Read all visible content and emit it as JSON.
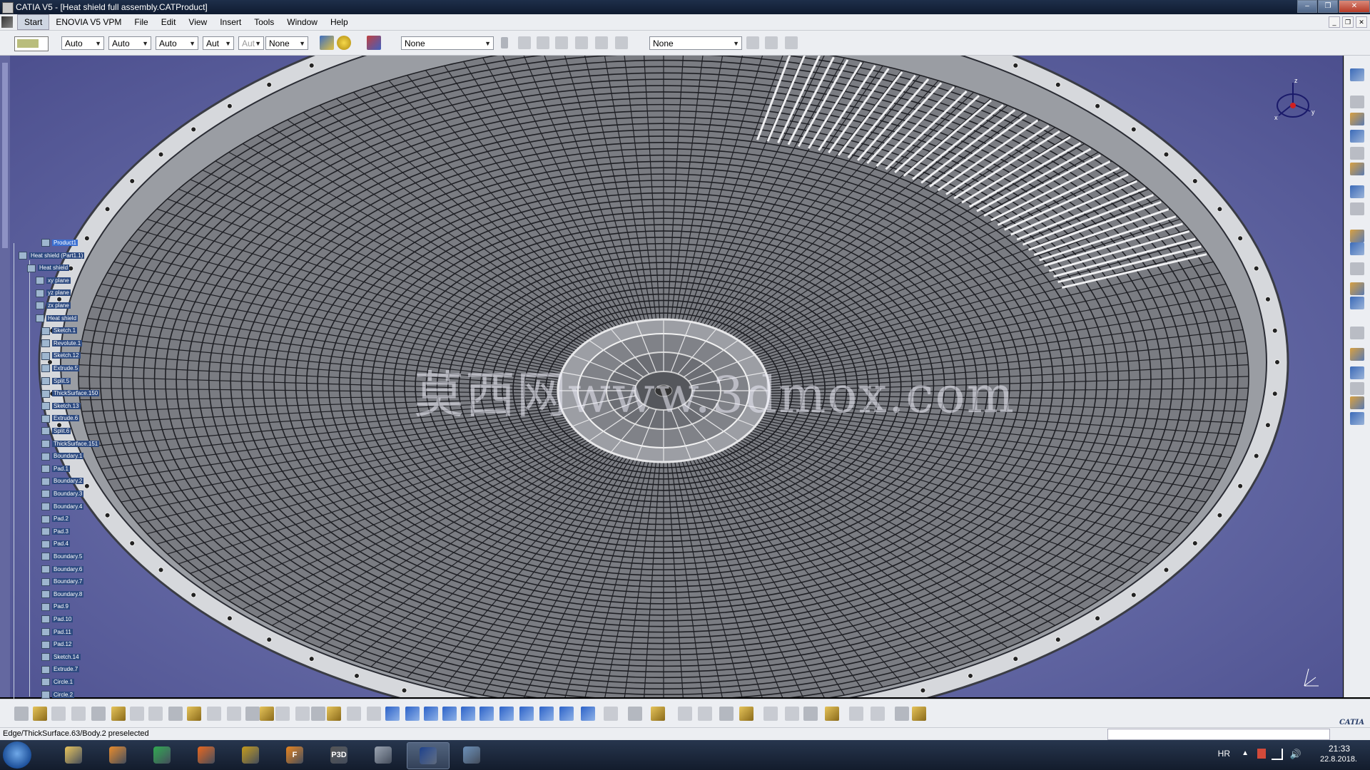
{
  "window": {
    "title": "CATIA V5 - [Heat shield full assembly.CATProduct]"
  },
  "menu": [
    "Start",
    "ENOVIA V5 VPM",
    "File",
    "Edit",
    "View",
    "Insert",
    "Tools",
    "Window",
    "Help"
  ],
  "toolbar": {
    "combos": [
      {
        "value": "Auto",
        "disabled": false
      },
      {
        "value": "Auto",
        "disabled": false
      },
      {
        "value": "Auto",
        "disabled": false
      },
      {
        "value": "Aut",
        "disabled": false
      },
      {
        "value": "Aut",
        "disabled": true
      },
      {
        "value": "None",
        "disabled": false
      }
    ],
    "layer_select": "None",
    "filter_select": "None"
  },
  "tree": {
    "nodes": [
      {
        "label": "Product1"
      },
      {
        "label": "Heat shield (Part1.1)"
      },
      {
        "label": "Heat shield"
      },
      {
        "label": "xy plane"
      },
      {
        "label": "yz plane"
      },
      {
        "label": "zx plane"
      },
      {
        "label": "Heat shield"
      },
      {
        "label": "Sketch.1"
      },
      {
        "label": "Revolute.1"
      },
      {
        "label": "Sketch.12"
      },
      {
        "label": "Extrude.5"
      },
      {
        "label": "Split.5"
      },
      {
        "label": "ThickSurface.150"
      },
      {
        "label": "Sketch.13"
      },
      {
        "label": "Extrude.6"
      },
      {
        "label": "Split.6"
      },
      {
        "label": "ThickSurface.151"
      },
      {
        "label": "Boundary.1"
      },
      {
        "label": "Pad.1"
      },
      {
        "label": "Boundary.2"
      },
      {
        "label": "Boundary.3"
      },
      {
        "label": "Boundary.4"
      },
      {
        "label": "Pad.2"
      },
      {
        "label": "Pad.3"
      },
      {
        "label": "Pad.4"
      },
      {
        "label": "Boundary.5"
      },
      {
        "label": "Boundary.6"
      },
      {
        "label": "Boundary.7"
      },
      {
        "label": "Boundary.8"
      },
      {
        "label": "Pad.9"
      },
      {
        "label": "Pad.10"
      },
      {
        "label": "Pad.11"
      },
      {
        "label": "Pad.12"
      },
      {
        "label": "Sketch.14"
      },
      {
        "label": "Extrude.7"
      },
      {
        "label": "Circle.1"
      },
      {
        "label": "Circle.2"
      }
    ]
  },
  "viewport": {
    "watermark": "莫西网www.3dmox.com",
    "compass": {
      "x": "x",
      "y": "y",
      "z": "z"
    }
  },
  "status": {
    "text": "Edge/ThickSurface.63/Body.2 preselected"
  },
  "catia_logo": "CATIA",
  "taskbar": {
    "apps": [
      {
        "name": "explorer",
        "label": "",
        "color": "#e8c45a"
      },
      {
        "name": "media-player",
        "label": "",
        "color": "#e88a2a"
      },
      {
        "name": "chrome",
        "label": "",
        "color": "#2fa84f"
      },
      {
        "name": "firefox",
        "label": "",
        "color": "#e8651c"
      },
      {
        "name": "app-eagle",
        "label": "",
        "color": "#c49a1a"
      },
      {
        "name": "app-f",
        "label": "F",
        "color": "#e8831c"
      },
      {
        "name": "p3d",
        "label": "P3D",
        "color": "#555555"
      },
      {
        "name": "airplane",
        "label": "",
        "color": "#9aa3b0"
      },
      {
        "name": "catia",
        "label": "",
        "color": "#1c3f8a"
      },
      {
        "name": "app-plane2",
        "label": "",
        "color": "#6a8fb8"
      }
    ],
    "lang": "HR",
    "time": "21:33",
    "date": "22.8.2018."
  }
}
